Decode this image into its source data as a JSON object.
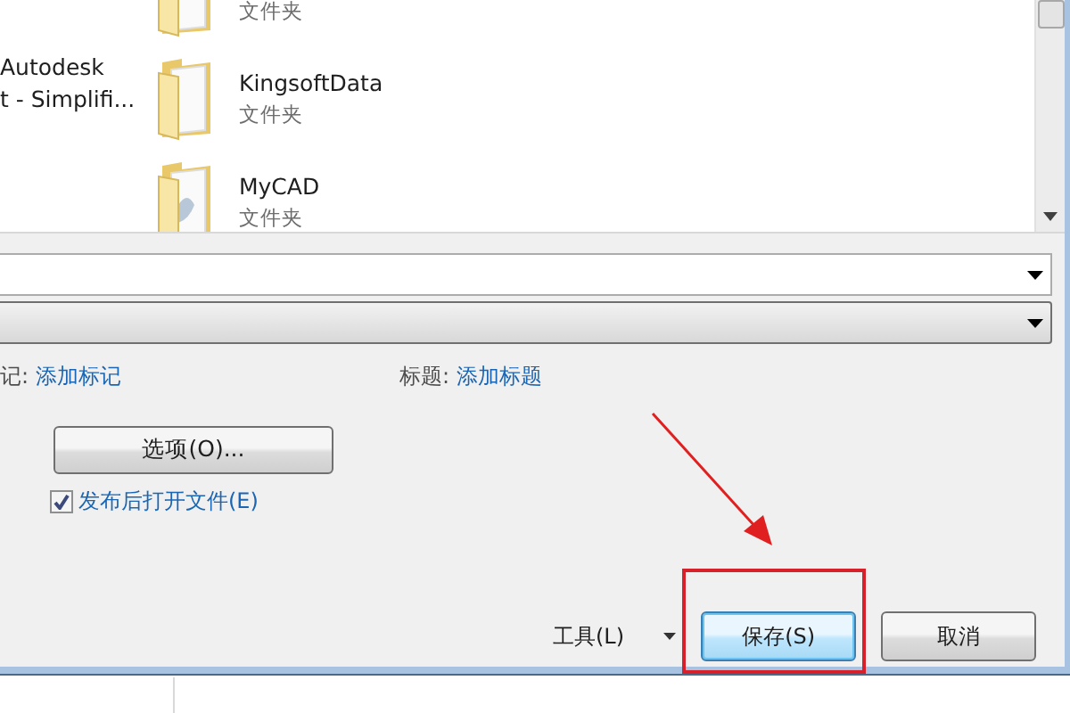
{
  "nav_pane": {
    "lines": [
      "Autodesk",
      "t - Simplifi..."
    ]
  },
  "files": [
    {
      "type": "文件夹"
    },
    {
      "name": "KingsoftData",
      "type": "文件夹"
    },
    {
      "name": "MyCAD",
      "type": "文件夹"
    }
  ],
  "metadata": {
    "tags_label": "记:",
    "tags_link": "添加标记",
    "title_label": "标题:",
    "title_link": "添加标题"
  },
  "options_button": "选项(O)...",
  "open_after_publish": {
    "label": "发布后打开文件(E)",
    "checked": true
  },
  "tools_menu": "工具(L)",
  "buttons": [
    {
      "label": "保存(S)",
      "selected": true
    },
    {
      "label": "取消",
      "selected": false
    }
  ]
}
